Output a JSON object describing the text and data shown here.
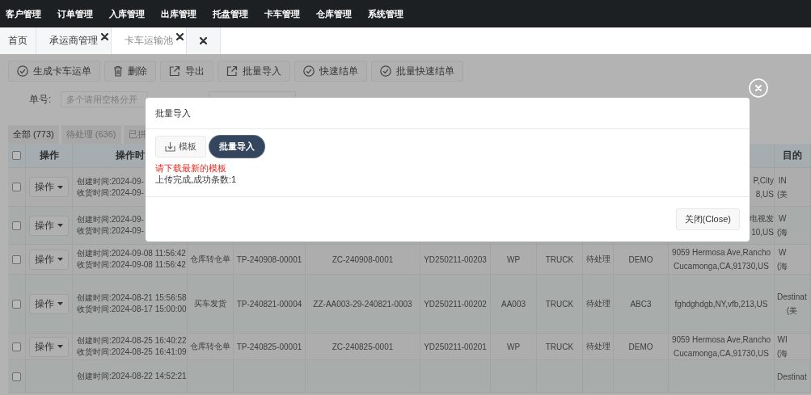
{
  "nav": {
    "items": [
      "客户管理",
      "订单管理",
      "入库管理",
      "出库管理",
      "托盘管理",
      "卡车管理",
      "仓库管理",
      "系统管理"
    ]
  },
  "page_tabs": {
    "items": [
      {
        "label": "首页",
        "closable": false,
        "selected": false
      },
      {
        "label": "承运商管理",
        "closable": true,
        "selected": false
      },
      {
        "label": "卡车运输池",
        "closable": true,
        "selected": true
      }
    ]
  },
  "toolbar": [
    {
      "label": "生成卡车运单",
      "kind": "check"
    },
    {
      "label": "删除",
      "kind": "trash"
    },
    {
      "label": "导出",
      "kind": "export"
    },
    {
      "label": "批量导入",
      "kind": "export"
    },
    {
      "label": "快速结单",
      "kind": "check"
    },
    {
      "label": "批量快速结单",
      "kind": "check"
    }
  ],
  "filters": {
    "label": "单号:",
    "placeholder": "多个请用空格分开"
  },
  "status_tabs": [
    {
      "label": "全部 (773)",
      "selected": true
    },
    {
      "label": "待处理 (636)",
      "selected": false
    },
    {
      "label": "已拼",
      "selected": false
    }
  ],
  "table": {
    "select_all_checked": false,
    "header": {
      "actions": "操作",
      "time": "操作时",
      "destination": "目的"
    },
    "rows": [
      {
        "checked": false,
        "action": "操作",
        "created": "创建时间:2024-09-",
        "received": "收货时间:2024-09-",
        "address": [
          "P,City",
          "8,US"
        ],
        "destination": [
          "IN",
          "(美"
        ]
      },
      {
        "checked": false,
        "action": "操作",
        "created": "创建时间:2024-09-",
        "received": "收货时间:2024-09-",
        "address": [
          "电视发",
          "10,US"
        ],
        "destination": [
          "W",
          "(海"
        ]
      },
      {
        "checked": false,
        "action": "操作",
        "created": "创建时间:2024-09-08 11:56:42",
        "received": "收货时间:2024-09-08 11:56:42",
        "type": "仓库转仓单",
        "tp": "TP-240908-00001",
        "zc": "ZC-240908-0001",
        "yd": "YD250211-00203",
        "customer": "WP",
        "mode": "TRUCK",
        "status": "待处理",
        "warehouse": "DEMO",
        "address": [
          "9059 Hermosa Ave,Rancho",
          "Cucamonga,CA,91730,US"
        ],
        "destination": [
          "W",
          "(海"
        ]
      },
      {
        "checked": false,
        "action": "操作",
        "created": "创建时间:2024-08-21 15:56:58",
        "received": "收货时间:2024-08-17 15:00:00",
        "type": "买车发货",
        "tp": "TP-240821-00004",
        "zc": "ZZ-AA003-29-240821-0003",
        "yd": "YD250211-00202",
        "customer": "AA003",
        "mode": "TRUCK",
        "status": "待处理",
        "warehouse": "ABC3",
        "address": [
          "fghdghdgb,NY,vfb,213,US"
        ],
        "destination": [
          "Destinat",
          "(美"
        ]
      },
      {
        "checked": false,
        "action": "操作",
        "created": "创建时间:2024-08-25 16:40:22",
        "received": "收货时间:2024-08-25 16:41:09",
        "type": "仓库转仓单",
        "tp": "TP-240825-00001",
        "zc": "ZC-240825-0001",
        "yd": "YD250211-00201",
        "customer": "WP",
        "mode": "TRUCK",
        "status": "待处理",
        "warehouse": "DEMO",
        "address": [
          "9059 Hermosa Ave,Rancho",
          "Cucamonga,CA,91730,US"
        ],
        "destination": [
          "WI",
          "(海"
        ]
      },
      {
        "checked": false,
        "created": "创建时间:2024-08-22 14:52:21",
        "destination": [
          "Destinat"
        ]
      }
    ]
  },
  "dialog": {
    "title": "批量导入",
    "template_button": "模板",
    "import_button": "批量导入",
    "warning": "请下载最新的模板",
    "result": "上传完成,成功条数:1",
    "close_button": "关闭(Close)"
  }
}
